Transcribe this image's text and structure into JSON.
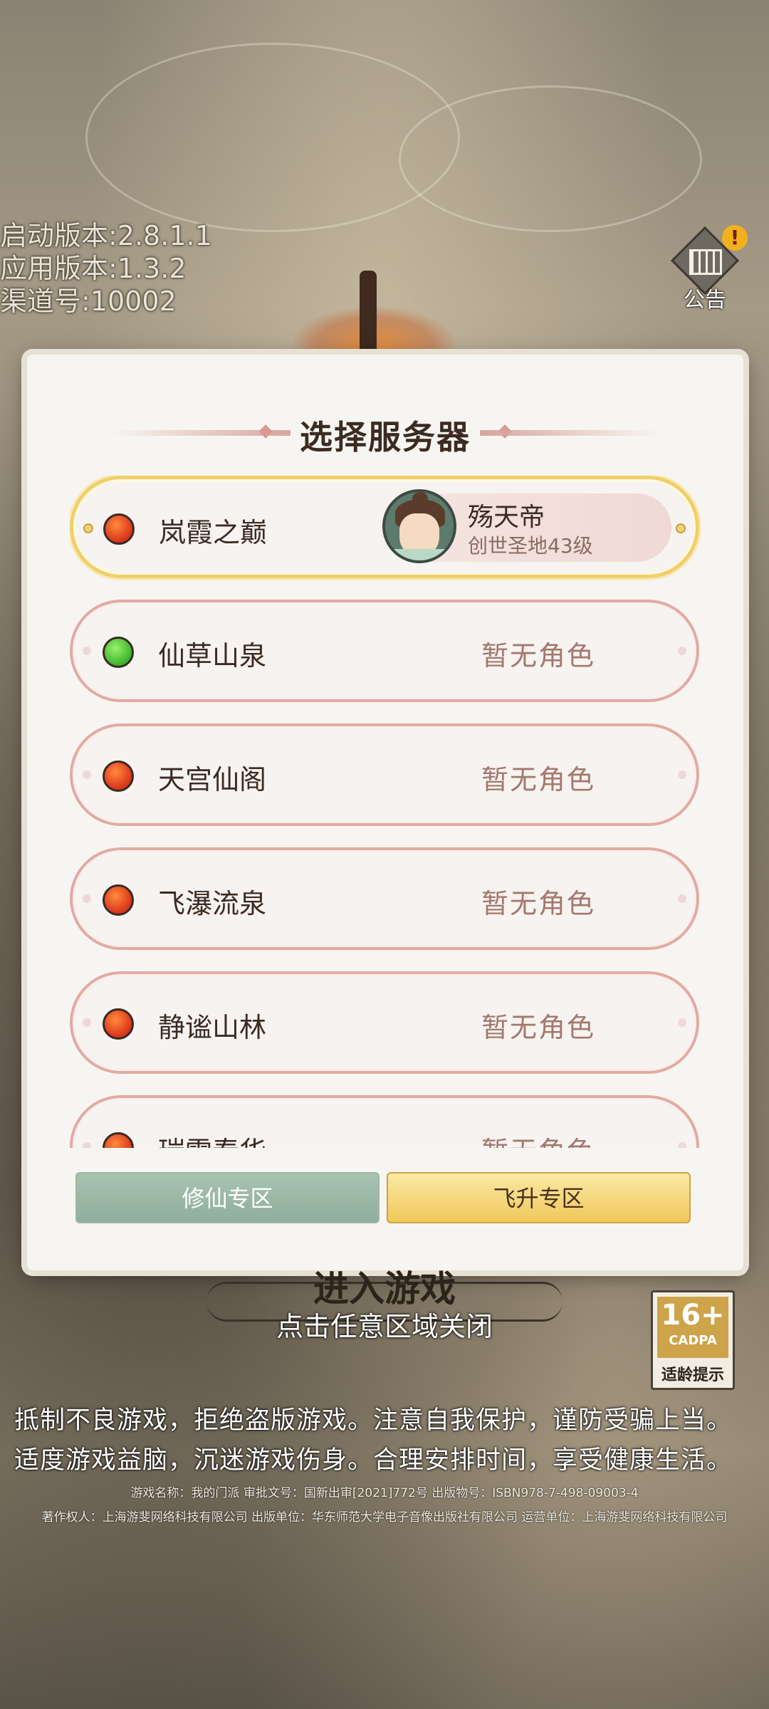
{
  "version_info": {
    "launcher": "启动版本:2.8.1.1",
    "app": "应用版本:1.3.2",
    "channel": "渠道号:10002"
  },
  "notice": {
    "label": "公告",
    "alert": "!"
  },
  "dialog": {
    "title": "选择服务器",
    "servers": [
      {
        "name": "岚霞之巅",
        "status": "busy",
        "selected": true,
        "character": {
          "name": "殇天帝",
          "level": "创世圣地43级"
        }
      },
      {
        "name": "仙草山泉",
        "status": "free",
        "role": "暂无角色"
      },
      {
        "name": "天宫仙阁",
        "status": "busy",
        "role": "暂无角色"
      },
      {
        "name": "飞瀑流泉",
        "status": "busy",
        "role": "暂无角色"
      },
      {
        "name": "静谧山林",
        "status": "busy",
        "role": "暂无角色"
      },
      {
        "name": "瑞雪春华",
        "status": "busy",
        "role": "暂无角色"
      }
    ],
    "tabs": {
      "left": "修仙专区",
      "right": "飞升专区"
    }
  },
  "enter_game": "进入游戏",
  "close_hint": "点击任意区域关闭",
  "age_rating": {
    "rating": "16+",
    "org": "CADPA",
    "tip": "适龄提示"
  },
  "health_notice": {
    "line1": "抵制不良游戏，拒绝盗版游戏。注意自我保护，谨防受骗上当。",
    "line2": "适度游戏益脑，沉迷游戏伤身。合理安排时间，享受健康生活。"
  },
  "legal": {
    "line1": "游戏名称：我的门派 审批文号：国新出审[2021]772号 出版物号：ISBN978-7-498-09003-4",
    "line2": "著作权人：上海游斐网络科技有限公司 出版单位：华东师范大学电子音像出版社有限公司 运营单位：上海游斐网络科技有限公司"
  },
  "colors": {
    "busy": "#d8341a",
    "free": "#39b52a",
    "accent_gold": "#f0cf6b",
    "border_pink": "#e2aaa3"
  }
}
